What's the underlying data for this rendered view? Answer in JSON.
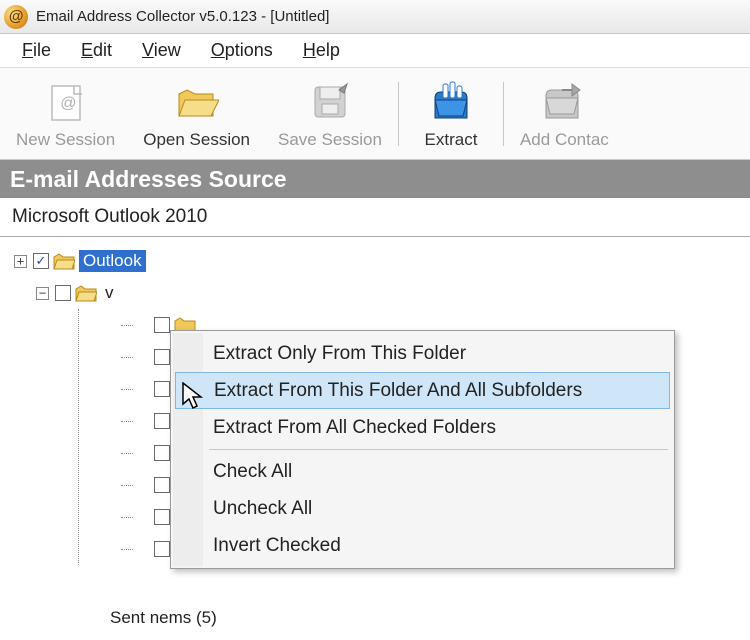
{
  "title": "Email Address Collector v5.0.123 - [Untitled]",
  "app_icon_glyph": "@",
  "menu": {
    "file": "File",
    "edit": "Edit",
    "view": "View",
    "options": "Options",
    "help": "Help"
  },
  "toolbar": {
    "new_session": "New Session",
    "open_session": "Open Session",
    "save_session": "Save Session",
    "extract": "Extract",
    "add_contact": "Add Contac"
  },
  "panel_heading": "E-mail Addresses Source",
  "source_name": "Microsoft Outlook 2010",
  "tree": {
    "root": "Outlook",
    "child_v": "v",
    "obscured": "Sent nems (5)"
  },
  "context_menu": {
    "extract_only": "Extract Only From This Folder",
    "extract_sub": "Extract From This Folder And All Subfolders",
    "extract_checked": "Extract From All Checked Folders",
    "check_all": "Check All",
    "uncheck_all": "Uncheck All",
    "invert": "Invert Checked"
  }
}
